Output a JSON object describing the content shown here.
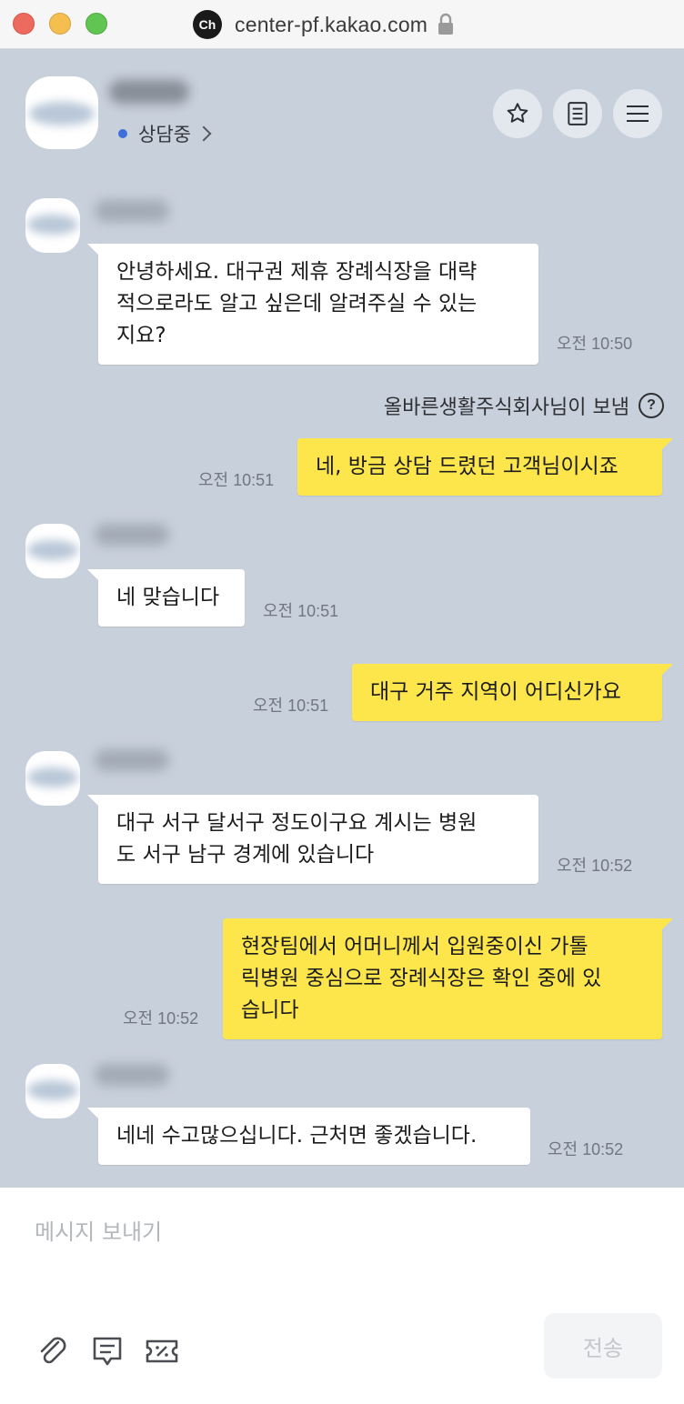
{
  "window": {
    "url": "center-pf.kakao.com",
    "badge": "Ch"
  },
  "header": {
    "status": "상담중",
    "status_color": "#3f6fd8",
    "buttons": [
      "star-icon",
      "document-icon",
      "menu-icon"
    ]
  },
  "messages": [
    {
      "dir": "in",
      "text": "안녕하세요. 대구권 제휴 장례식장을 대략\n적으로라도 알고 싶은데 알려주실 수 있는\n지요?",
      "time": "오전 10:50"
    },
    {
      "dir": "out",
      "text": "네, 방금 상담 드렸던 고객님이시죠",
      "time": "오전 10:51"
    },
    {
      "dir": "in",
      "text": "네 맞습니다",
      "time": "오전 10:51"
    },
    {
      "dir": "out",
      "text": "대구 거주 지역이 어디신가요",
      "time": "오전 10:51"
    },
    {
      "dir": "in",
      "text": "대구 서구 달서구 정도이구요 계시는 병원\n도 서구 남구 경계에 있습니다",
      "time": "오전 10:52"
    },
    {
      "dir": "out",
      "text": "현장팀에서 어머니께서 입원중이신 가톨\n릭병원 중심으로 장례식장은 확인 중에 있\n습니다",
      "time": "오전 10:52"
    },
    {
      "dir": "in",
      "text": "네네 수고많으십니다. 근처면 좋겠습니다.",
      "time": "오전 10:52"
    }
  ],
  "sender_note": "올바른생활주식회사님이 보냄",
  "sender_note_icon": "?",
  "composer": {
    "placeholder": "메시지 보내기",
    "send_label": "전송"
  },
  "colors": {
    "chat_bg": "#c8d0dc",
    "incoming_bubble": "#ffffff",
    "outgoing_bubble": "#fce64c"
  }
}
